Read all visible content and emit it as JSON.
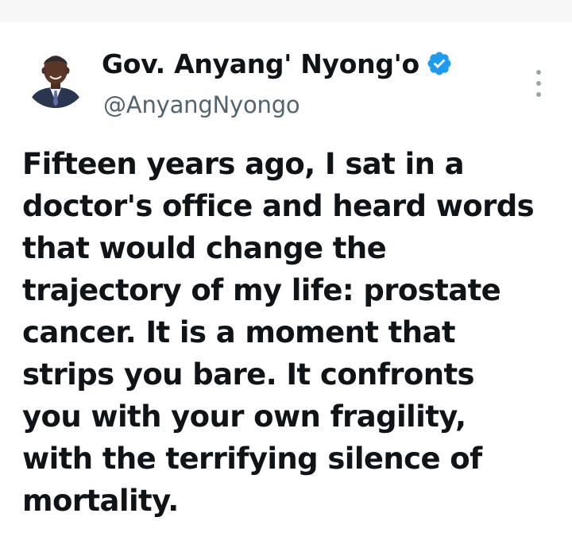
{
  "author": {
    "display_name": "Gov. Anyang' Nyong'o",
    "handle": "@AnyangNyongo",
    "verified": true,
    "verified_color": "#1d9bf0",
    "avatar_icon": "user-photo"
  },
  "post": {
    "lines": [
      "Fifteen years ago, I sat in a",
      "doctor's office and heard words",
      "that would change the",
      "trajectory of my life: prostate",
      "cancer. It is a moment that",
      "strips you bare. It confronts",
      "you with your own fragility,",
      "with the terrifying silence of",
      "mortality."
    ]
  },
  "actions": {
    "more_icon": "more-vertical-icon"
  }
}
